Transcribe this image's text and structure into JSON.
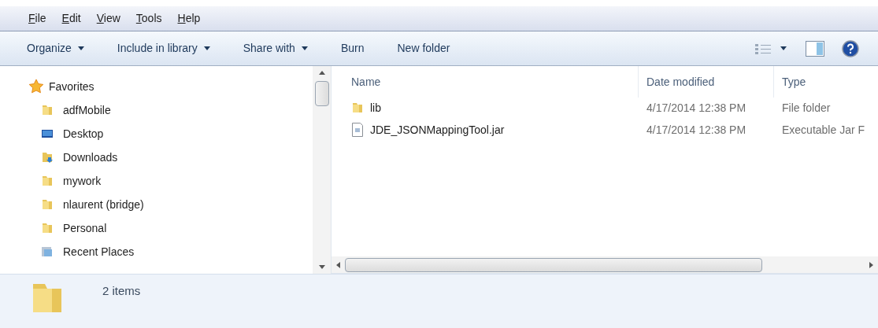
{
  "menu": [
    "File",
    "Edit",
    "View",
    "Tools",
    "Help"
  ],
  "toolbar": [
    {
      "label": "Organize",
      "dropdown": true
    },
    {
      "label": "Include in library",
      "dropdown": true
    },
    {
      "label": "Share with",
      "dropdown": true
    },
    {
      "label": "Burn",
      "dropdown": false
    },
    {
      "label": "New folder",
      "dropdown": false
    }
  ],
  "navigation": {
    "header": "Favorites",
    "items": [
      {
        "label": "adfMobile",
        "kind": "folder"
      },
      {
        "label": "Desktop",
        "kind": "desktop"
      },
      {
        "label": "Downloads",
        "kind": "downloads"
      },
      {
        "label": "mywork",
        "kind": "folder"
      },
      {
        "label": "nlaurent (bridge)",
        "kind": "folder"
      },
      {
        "label": "Personal",
        "kind": "folder"
      },
      {
        "label": "Recent Places",
        "kind": "recent"
      }
    ]
  },
  "file_list": {
    "columns": [
      "Name",
      "Date modified",
      "Type"
    ],
    "rows": [
      {
        "name": "lib",
        "kind": "folder",
        "date": "4/17/2014 12:38 PM",
        "type": "File folder"
      },
      {
        "name": "JDE_JSONMappingTool.jar",
        "kind": "file",
        "date": "4/17/2014 12:38 PM",
        "type": "Executable Jar F"
      }
    ]
  },
  "details": {
    "count": "2 items"
  }
}
